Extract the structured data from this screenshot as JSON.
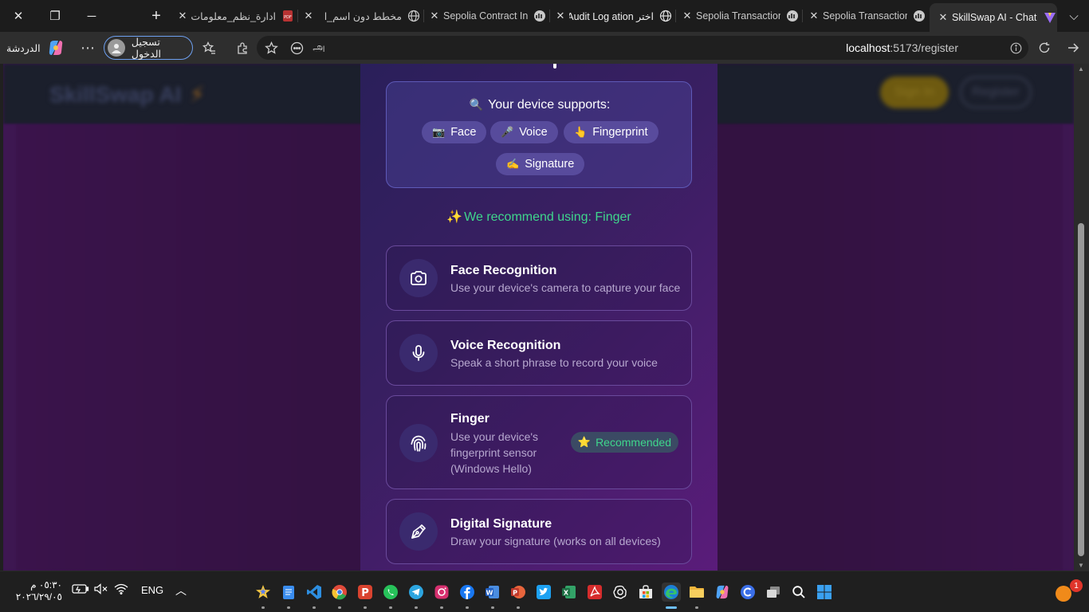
{
  "browser": {
    "tabs": [
      {
        "title": "SkillSwap AI - Chat",
        "active": true,
        "icon": "vite-icon"
      },
      {
        "title": "Sepolia Transaction",
        "icon": "etherscan-icon"
      },
      {
        "title": "Sepolia Transaction",
        "icon": "etherscan-icon"
      },
      {
        "title": "اختر Audit Log ation",
        "icon": "globe-icon"
      },
      {
        "title": "Sepolia Contract In",
        "icon": "etherscan-icon"
      },
      {
        "title": "مخطط دون اسم_ا",
        "icon": "globe-icon"
      },
      {
        "title": "ادارة_نظم_معلومات",
        "icon": "pdf-icon"
      }
    ],
    "url_host": "localhost",
    "url_path": ":5173/register",
    "profile_label": "تسجيل الدخول",
    "copilot_label": "الدردشة"
  },
  "site": {
    "logo": "SkillSwap AI",
    "logo_symbol": "⚡",
    "signin_label": "Sign In",
    "register_label": "Register"
  },
  "modal": {
    "supports_title": "Your device supports:",
    "chips": [
      {
        "icon": "📷",
        "label": "Face"
      },
      {
        "icon": "🎤",
        "label": "Voice"
      },
      {
        "icon": "👆",
        "label": "Fingerprint"
      },
      {
        "icon": "✍️",
        "label": "Signature"
      }
    ],
    "recommend_text": "We recommend using: Finger",
    "recommend_icon": "✨",
    "methods": [
      {
        "title": "Face Recognition",
        "desc": "Use your device's camera to capture your face",
        "icon": "camera-icon"
      },
      {
        "title": "Voice Recognition",
        "desc": "Speak a short phrase to record your voice",
        "icon": "microphone-icon"
      },
      {
        "title": "Finger",
        "desc": "Use your device's fingerprint sensor (Windows Hello)",
        "icon": "fingerprint-icon",
        "badge": "Recommended",
        "badge_icon": "⭐"
      },
      {
        "title": "Digital Signature",
        "desc": "Draw your signature (works on all devices)",
        "icon": "pen-icon"
      }
    ]
  },
  "taskbar": {
    "time": "٠٥:٣٠ م",
    "date": "٢٠٢٦/٢٩/٠٥",
    "language": "ENG",
    "notification_count": "1"
  },
  "colors": {
    "accent_green": "#3fd68c",
    "modal_start": "#2a1f5a",
    "modal_end": "#5a1c7a"
  }
}
